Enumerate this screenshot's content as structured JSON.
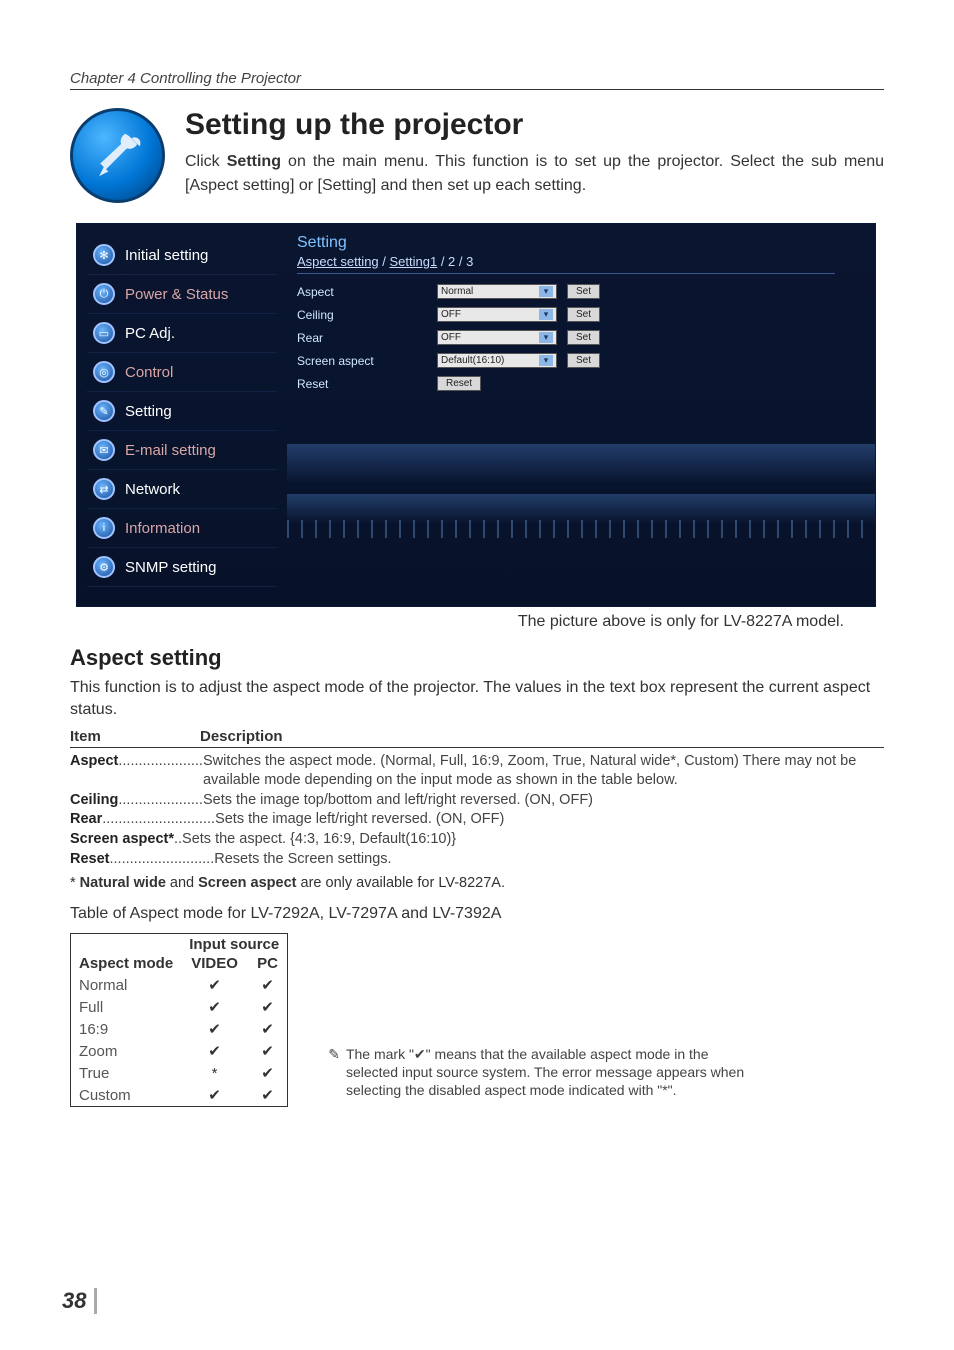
{
  "chapter": "Chapter 4 Controlling the Projector",
  "title": "Setting up the projector",
  "intro_pre": "Click ",
  "intro_bold": "Setting",
  "intro_post": " on the main menu. This function is to set up the projector. Select the sub menu [Aspect setting] or [Setting] and then set up each setting.",
  "sidebar": [
    {
      "label": "Initial setting",
      "cls": "white",
      "glyph": "✻"
    },
    {
      "label": "Power & Status",
      "cls": "alt",
      "glyph": "⏻"
    },
    {
      "label": "PC Adj.",
      "cls": "white",
      "glyph": "▭"
    },
    {
      "label": "Control",
      "cls": "alt",
      "glyph": "◎"
    },
    {
      "label": "Setting",
      "cls": "white",
      "glyph": "✎"
    },
    {
      "label": "E-mail setting",
      "cls": "alt",
      "glyph": "✉"
    },
    {
      "label": "Network",
      "cls": "white",
      "glyph": "⇄"
    },
    {
      "label": "Information",
      "cls": "alt",
      "glyph": "i"
    },
    {
      "label": "SNMP setting",
      "cls": "white",
      "glyph": "⚙"
    }
  ],
  "panel": {
    "title": "Setting",
    "tab1": "Aspect setting",
    "tab2": "Setting1",
    "tab_suffix": " / 2 / 3",
    "rows": [
      {
        "label": "Aspect",
        "value": "Normal",
        "btn": "Set"
      },
      {
        "label": "Ceiling",
        "value": "OFF",
        "btn": "Set"
      },
      {
        "label": "Rear",
        "value": "OFF",
        "btn": "Set"
      },
      {
        "label": "Screen aspect",
        "value": "Default(16:10)",
        "btn": "Set"
      },
      {
        "label": "Reset",
        "value": null,
        "btn": "Reset"
      }
    ]
  },
  "caption": "The picture above is only for LV-8227A model.",
  "aspect_heading": "Aspect setting",
  "aspect_intro": "This function is to adjust the aspect mode of the projector.  The values in the text box represent the current aspect status.",
  "desc_header": {
    "col1": "Item",
    "col2": "Description"
  },
  "items": [
    {
      "name": "Aspect",
      "dots": ".....................",
      "text": "Switches the aspect mode. (Normal, Full, 16:9, Zoom, True, Natural wide*, Custom) There may not be available mode depending on the input mode as shown in the table below."
    },
    {
      "name": "Ceiling",
      "dots": ".....................",
      "text": "Sets the image top/bottom and left/right reversed. (ON, OFF)"
    },
    {
      "name": "Rear",
      "dots": "............................",
      "text": "Sets the image left/right reversed. (ON, OFF)"
    },
    {
      "name": "Screen aspect*",
      "dots": "..",
      "text": "Sets the aspect. {4:3, 16:9, Default(16:10)}"
    },
    {
      "name": "Reset",
      "dots": "..........................",
      "text": "Resets the Screen settings."
    }
  ],
  "footnote_pre": "* ",
  "footnote_b1": "Natural wide",
  "footnote_mid": " and ",
  "footnote_b2": "Screen aspect",
  "footnote_post": " are only available for LV-8227A.",
  "table_caption": "Table of Aspect mode for LV-7292A, LV-7297A and LV-7392A",
  "table": {
    "group_header": "Input source",
    "header": {
      "mode": "Aspect mode",
      "c1": "VIDEO",
      "c2": "PC"
    },
    "rows": [
      {
        "mode": "Normal",
        "video": "✔",
        "pc": "✔"
      },
      {
        "mode": "Full",
        "video": "✔",
        "pc": "✔"
      },
      {
        "mode": "16:9",
        "video": "✔",
        "pc": "✔"
      },
      {
        "mode": "Zoom",
        "video": "✔",
        "pc": "✔"
      },
      {
        "mode": "True",
        "video": "*",
        "pc": "✔"
      },
      {
        "mode": "Custom",
        "video": "✔",
        "pc": "✔"
      }
    ]
  },
  "note": "The mark \"✔\" means that the available aspect mode in the selected input source system. The error message appears when selecting the disabled aspect mode indicated with \"*\".",
  "pagenum": "38"
}
